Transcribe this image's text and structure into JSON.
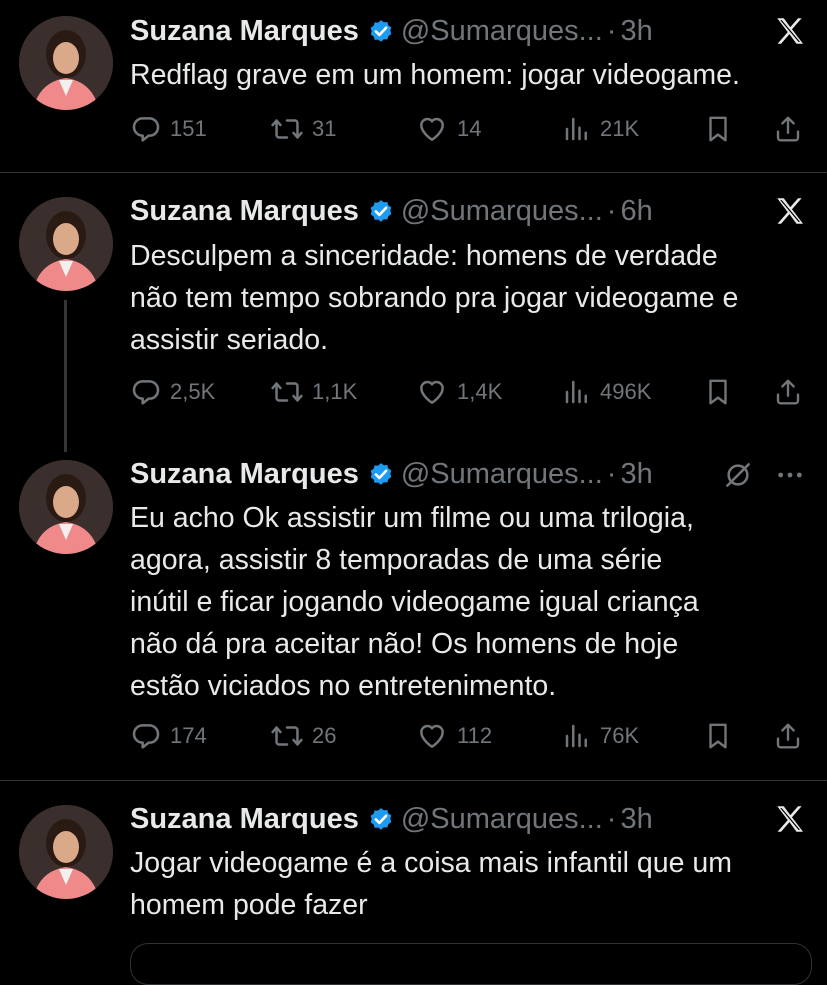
{
  "tweets": [
    {
      "name": "Suzana Marques",
      "handle": "@Sumarques...",
      "time": "3h",
      "text": "Redflag grave em um homem: jogar videogame.",
      "stats": {
        "replies": "151",
        "retweets": "31",
        "likes": "14",
        "views": "21K"
      }
    },
    {
      "name": "Suzana Marques",
      "handle": "@Sumarques...",
      "time": "6h",
      "text": "Desculpem a sinceridade: homens de verdade\nnão tem tempo sobrando pra jogar videogame e\nassistir seriado.",
      "stats": {
        "replies": "2,5K",
        "retweets": "1,1K",
        "likes": "1,4K",
        "views": "496K"
      }
    },
    {
      "name": "Suzana Marques",
      "handle": "@Sumarques...",
      "time": "3h",
      "text": "Eu acho Ok assistir um filme ou uma trilogia,\nagora, assistir 8 temporadas de uma série\ninútil e ficar jogando videogame igual criança\nnão dá pra aceitar não! Os homens de hoje\nestão viciados no entretenimento.",
      "stats": {
        "replies": "174",
        "retweets": "26",
        "likes": "112",
        "views": "76K"
      }
    },
    {
      "name": "Suzana Marques",
      "handle": "@Sumarques...",
      "time": "3h",
      "text": "Jogar videogame é a coisa mais infantil que um\nhomem pode fazer"
    }
  ],
  "separator": "·",
  "icons": [
    "x-logo-icon",
    "verified-badge-icon",
    "reply-icon",
    "retweet-icon",
    "like-icon",
    "views-icon",
    "bookmark-icon",
    "share-icon",
    "grok-icon",
    "more-icon"
  ],
  "colors": {
    "background": "#000000",
    "text": "#e7e9ea",
    "muted": "#71767b",
    "verified": "#1d9bf0",
    "divider": "#2f3336"
  }
}
